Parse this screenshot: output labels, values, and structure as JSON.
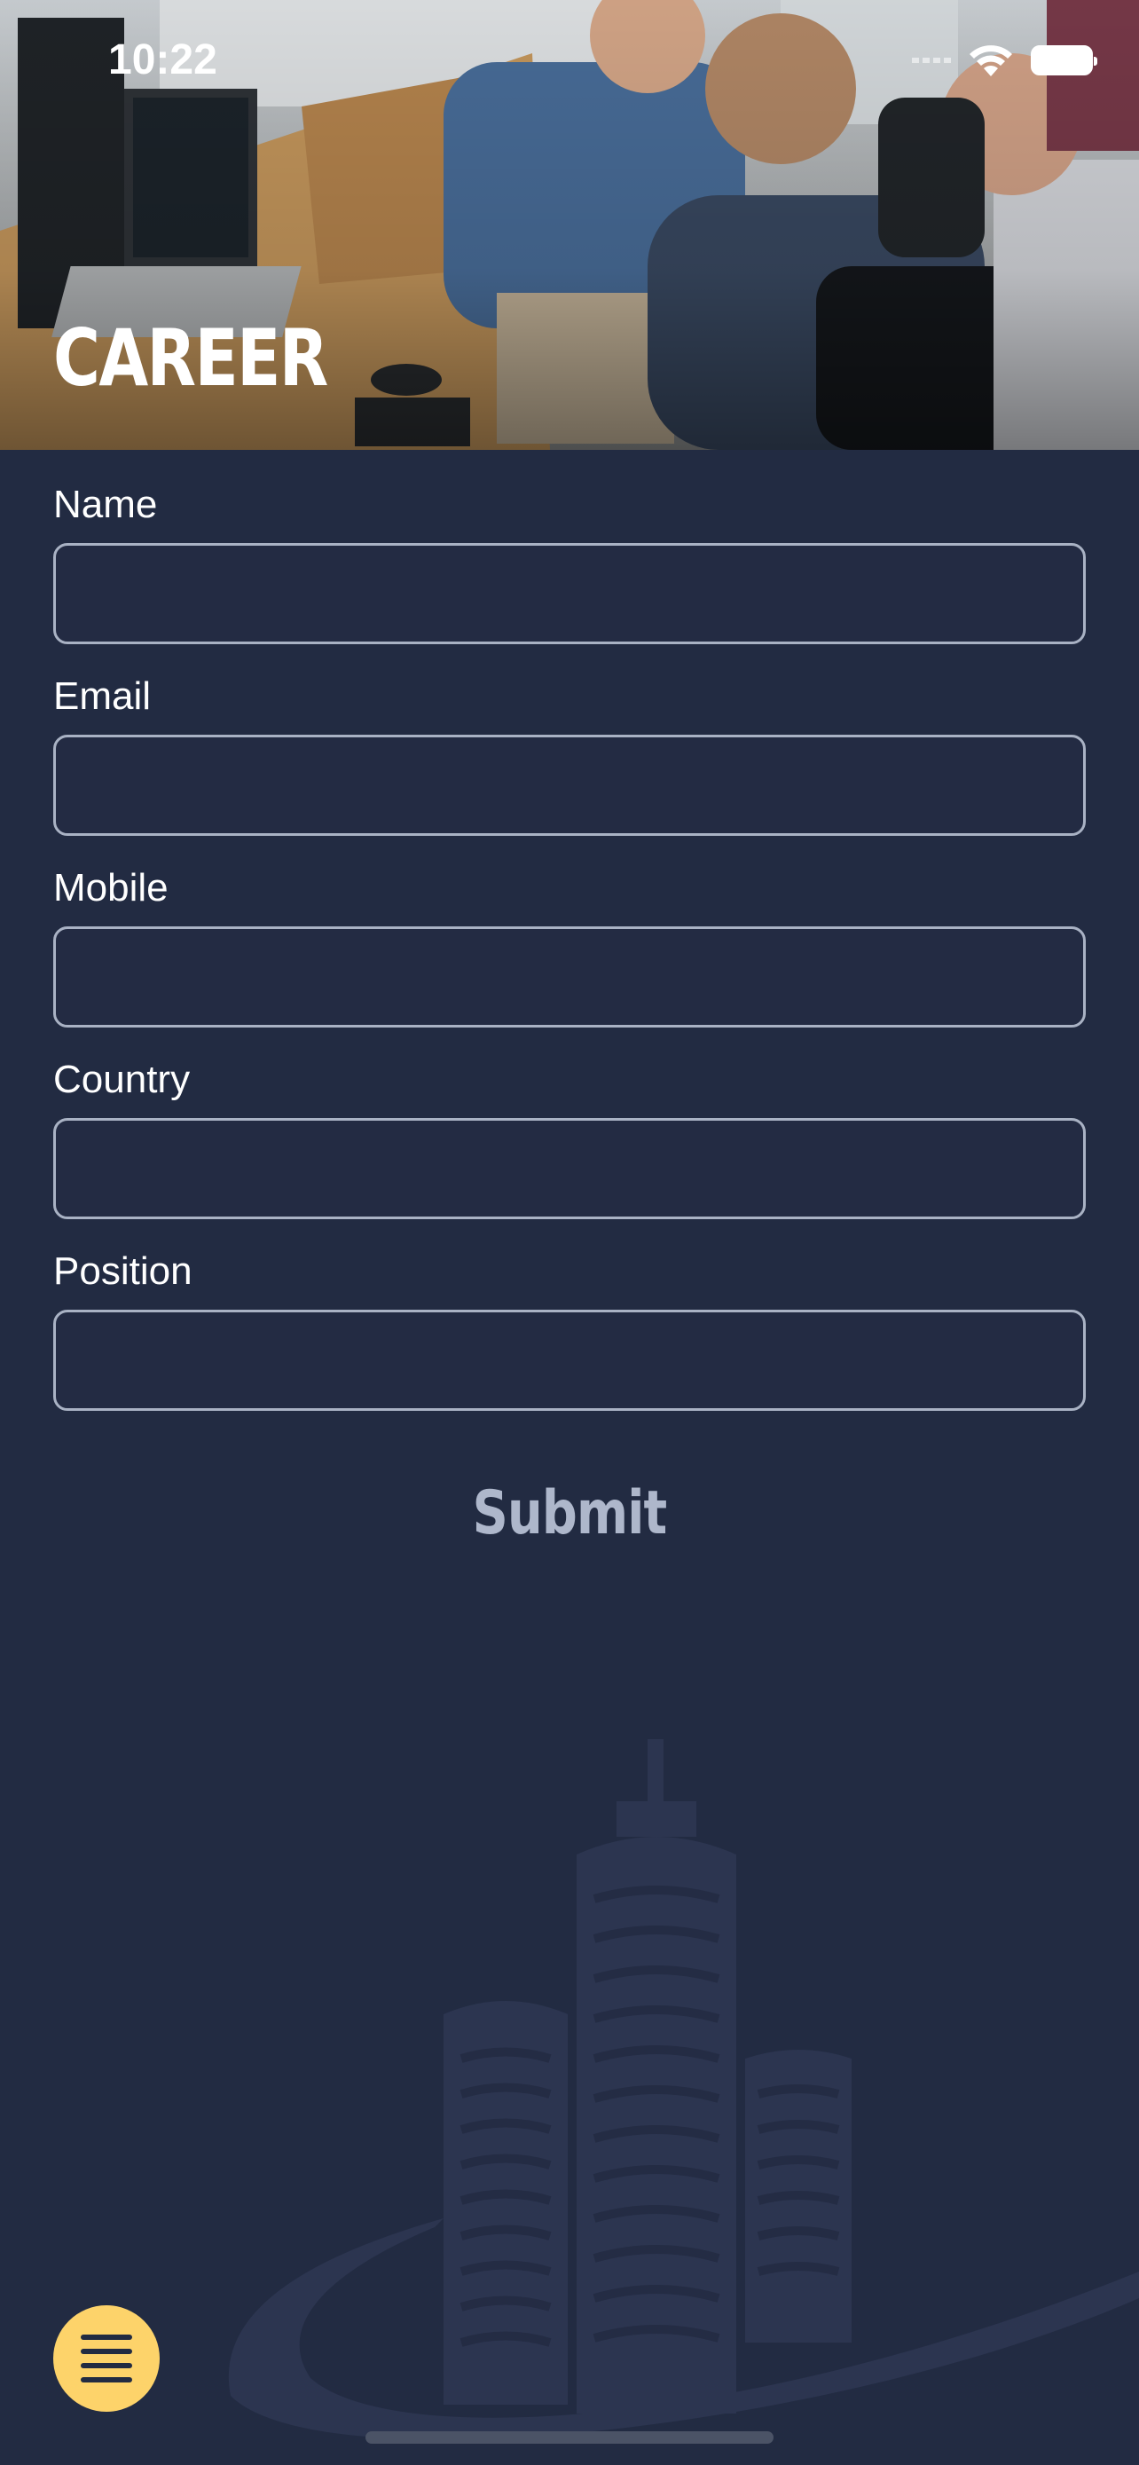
{
  "status_bar": {
    "time": "10:22"
  },
  "header": {
    "title": "CAREER"
  },
  "form": {
    "fields": [
      {
        "label": "Name",
        "value": "",
        "placeholder": ""
      },
      {
        "label": "Email",
        "value": "",
        "placeholder": ""
      },
      {
        "label": "Mobile",
        "value": "",
        "placeholder": ""
      },
      {
        "label": "Country",
        "value": "",
        "placeholder": ""
      },
      {
        "label": "Position",
        "value": "",
        "placeholder": ""
      }
    ],
    "submit_label": "Submit"
  },
  "menu": {
    "icon": "hamburger-menu-icon"
  },
  "colors": {
    "background": "#222b42",
    "input_border": "#a9b2c4",
    "submit_text": "#aeb7cb",
    "menu_button": "#fdd36a"
  }
}
